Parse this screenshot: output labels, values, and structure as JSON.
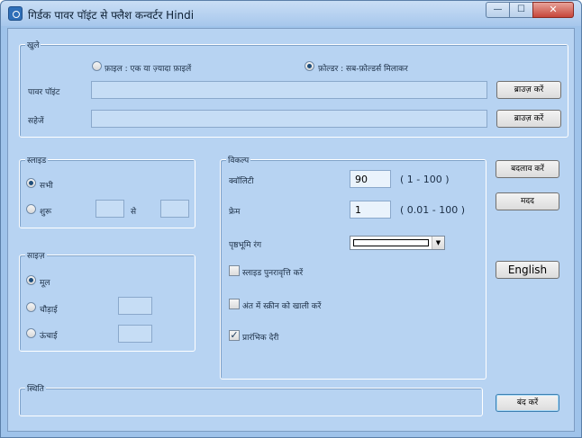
{
  "window": {
    "title": "गिर्डक पावर पॉइंट से फ्लैश कन्वर्टर Hindi",
    "min_glyph": "—",
    "max_glyph": "☐",
    "close_glyph": "✕"
  },
  "open_group": {
    "legend": "खुले",
    "file_radio_label": "फ़ाइल :  एक या ज़्यादा फ़ाइलें",
    "folder_radio_label": "फ़ोल्डर :  सब-फ़ोल्डर्स मिलाकर",
    "powerpoint_label": "पावर पॉइंट",
    "powerpoint_value": "",
    "save_label": "सहेजें",
    "save_value": "",
    "browse_label": "ब्राउज़ करें"
  },
  "slides_group": {
    "legend": "स्लाइड",
    "all_label": "सभी",
    "from_label": "शुरू",
    "to_label": "से",
    "from_value": "",
    "to_value": ""
  },
  "size_group": {
    "legend": "साइज़",
    "original_label": "मूल",
    "width_label": "चौड़ाई",
    "height_label": "ऊंचाई",
    "width_value": "",
    "height_value": ""
  },
  "options_group": {
    "legend": "विकल्प",
    "quality_label": "क्वॉलिटी",
    "quality_value": "90",
    "quality_range": "( 1 - 100 )",
    "frame_label": "फ्रेम",
    "frame_value": "1",
    "frame_range": "( 0.01 - 100 )",
    "bg_color_label": "पृष्ठभूमि रंग",
    "bg_color_value": "#ffffff",
    "repeat_slides_label": "स्लाइड पुनरावृत्ति करें",
    "repeat_slides_checked": false,
    "clear_screen_label": "अंत में स्क्रीन को खाली करें",
    "clear_screen_checked": false,
    "initial_delay_label": "प्रारंभिक देरी",
    "initial_delay_checked": true
  },
  "actions": {
    "convert_label": "बदलाव करें",
    "help_label": "मदद",
    "english_label": "English",
    "close_label": "बंद करें"
  },
  "status_group": {
    "legend": "स्थिति",
    "text": ""
  }
}
